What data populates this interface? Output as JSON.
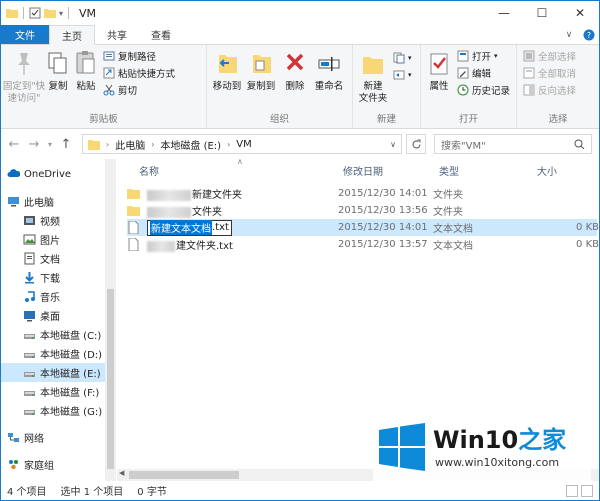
{
  "window": {
    "title": "VM"
  },
  "tabs": {
    "file": "文件",
    "home": "主页",
    "share": "共享",
    "view": "查看"
  },
  "ribbon": {
    "clipboard": {
      "label": "剪贴板",
      "pin": "固定到\"快速访问\"",
      "copy": "复制",
      "paste": "粘贴",
      "copy_path": "复制路径",
      "paste_shortcut": "粘贴快捷方式",
      "cut": "剪切"
    },
    "organize": {
      "label": "组织",
      "move_to": "移动到",
      "copy_to": "复制到",
      "delete": "删除",
      "rename": "重命名"
    },
    "new": {
      "label": "新建",
      "new_folder": "新建\n文件夹"
    },
    "open": {
      "label": "打开",
      "properties": "属性",
      "open": "打开",
      "edit": "编辑",
      "history": "历史记录"
    },
    "select": {
      "label": "选择",
      "select_all": "全部选择",
      "select_none": "全部取消",
      "invert": "反向选择"
    }
  },
  "address": {
    "parts": [
      "此电脑",
      "本地磁盘 (E:)",
      "VM"
    ]
  },
  "search": {
    "placeholder": "搜索\"VM\""
  },
  "columns": {
    "name": "名称",
    "date": "修改日期",
    "type": "类型",
    "size": "大小"
  },
  "nav": {
    "items": [
      {
        "label": "OneDrive",
        "icon": "cloud-icon"
      },
      {
        "label": "此电脑",
        "icon": "computer-icon"
      },
      {
        "label": "视频",
        "icon": "video-icon"
      },
      {
        "label": "图片",
        "icon": "picture-icon"
      },
      {
        "label": "文档",
        "icon": "document-icon"
      },
      {
        "label": "下载",
        "icon": "download-icon"
      },
      {
        "label": "音乐",
        "icon": "music-icon"
      },
      {
        "label": "桌面",
        "icon": "desktop-icon"
      },
      {
        "label": "本地磁盘 (C:)",
        "icon": "drive-icon"
      },
      {
        "label": "本地磁盘 (D:)",
        "icon": "drive-icon"
      },
      {
        "label": "本地磁盘 (E:)",
        "icon": "drive-icon"
      },
      {
        "label": "本地磁盘 (F:)",
        "icon": "drive-icon"
      },
      {
        "label": "本地磁盘 (G:)",
        "icon": "drive-icon"
      },
      {
        "label": "网络",
        "icon": "network-icon"
      },
      {
        "label": "家庭组",
        "icon": "homegroup-icon"
      }
    ]
  },
  "files": [
    {
      "name": "新建文件夹",
      "date": "2015/12/30 14:01",
      "type": "文件夹",
      "size": ""
    },
    {
      "name": "文件夹",
      "date": "2015/12/30 13:56",
      "type": "文件夹",
      "size": ""
    },
    {
      "name_hl": "新建文本文档",
      "name_ext": ".txt",
      "date": "2015/12/30 14:01",
      "type": "文本文档",
      "size": "0 KB"
    },
    {
      "name": "建文件夹.txt",
      "date": "2015/12/30 13:57",
      "type": "文本文档",
      "size": "0 KB"
    }
  ],
  "status": {
    "count": "4 个项目",
    "selected": "选中 1 个项目",
    "size": "0 字节"
  },
  "watermark": {
    "title_a": "Win10",
    "title_b": "之家",
    "url": "www.win10xitong.com"
  },
  "colors": {
    "accent": "#1979ca",
    "selection": "#cce8ff",
    "folder": "#f8d775"
  }
}
